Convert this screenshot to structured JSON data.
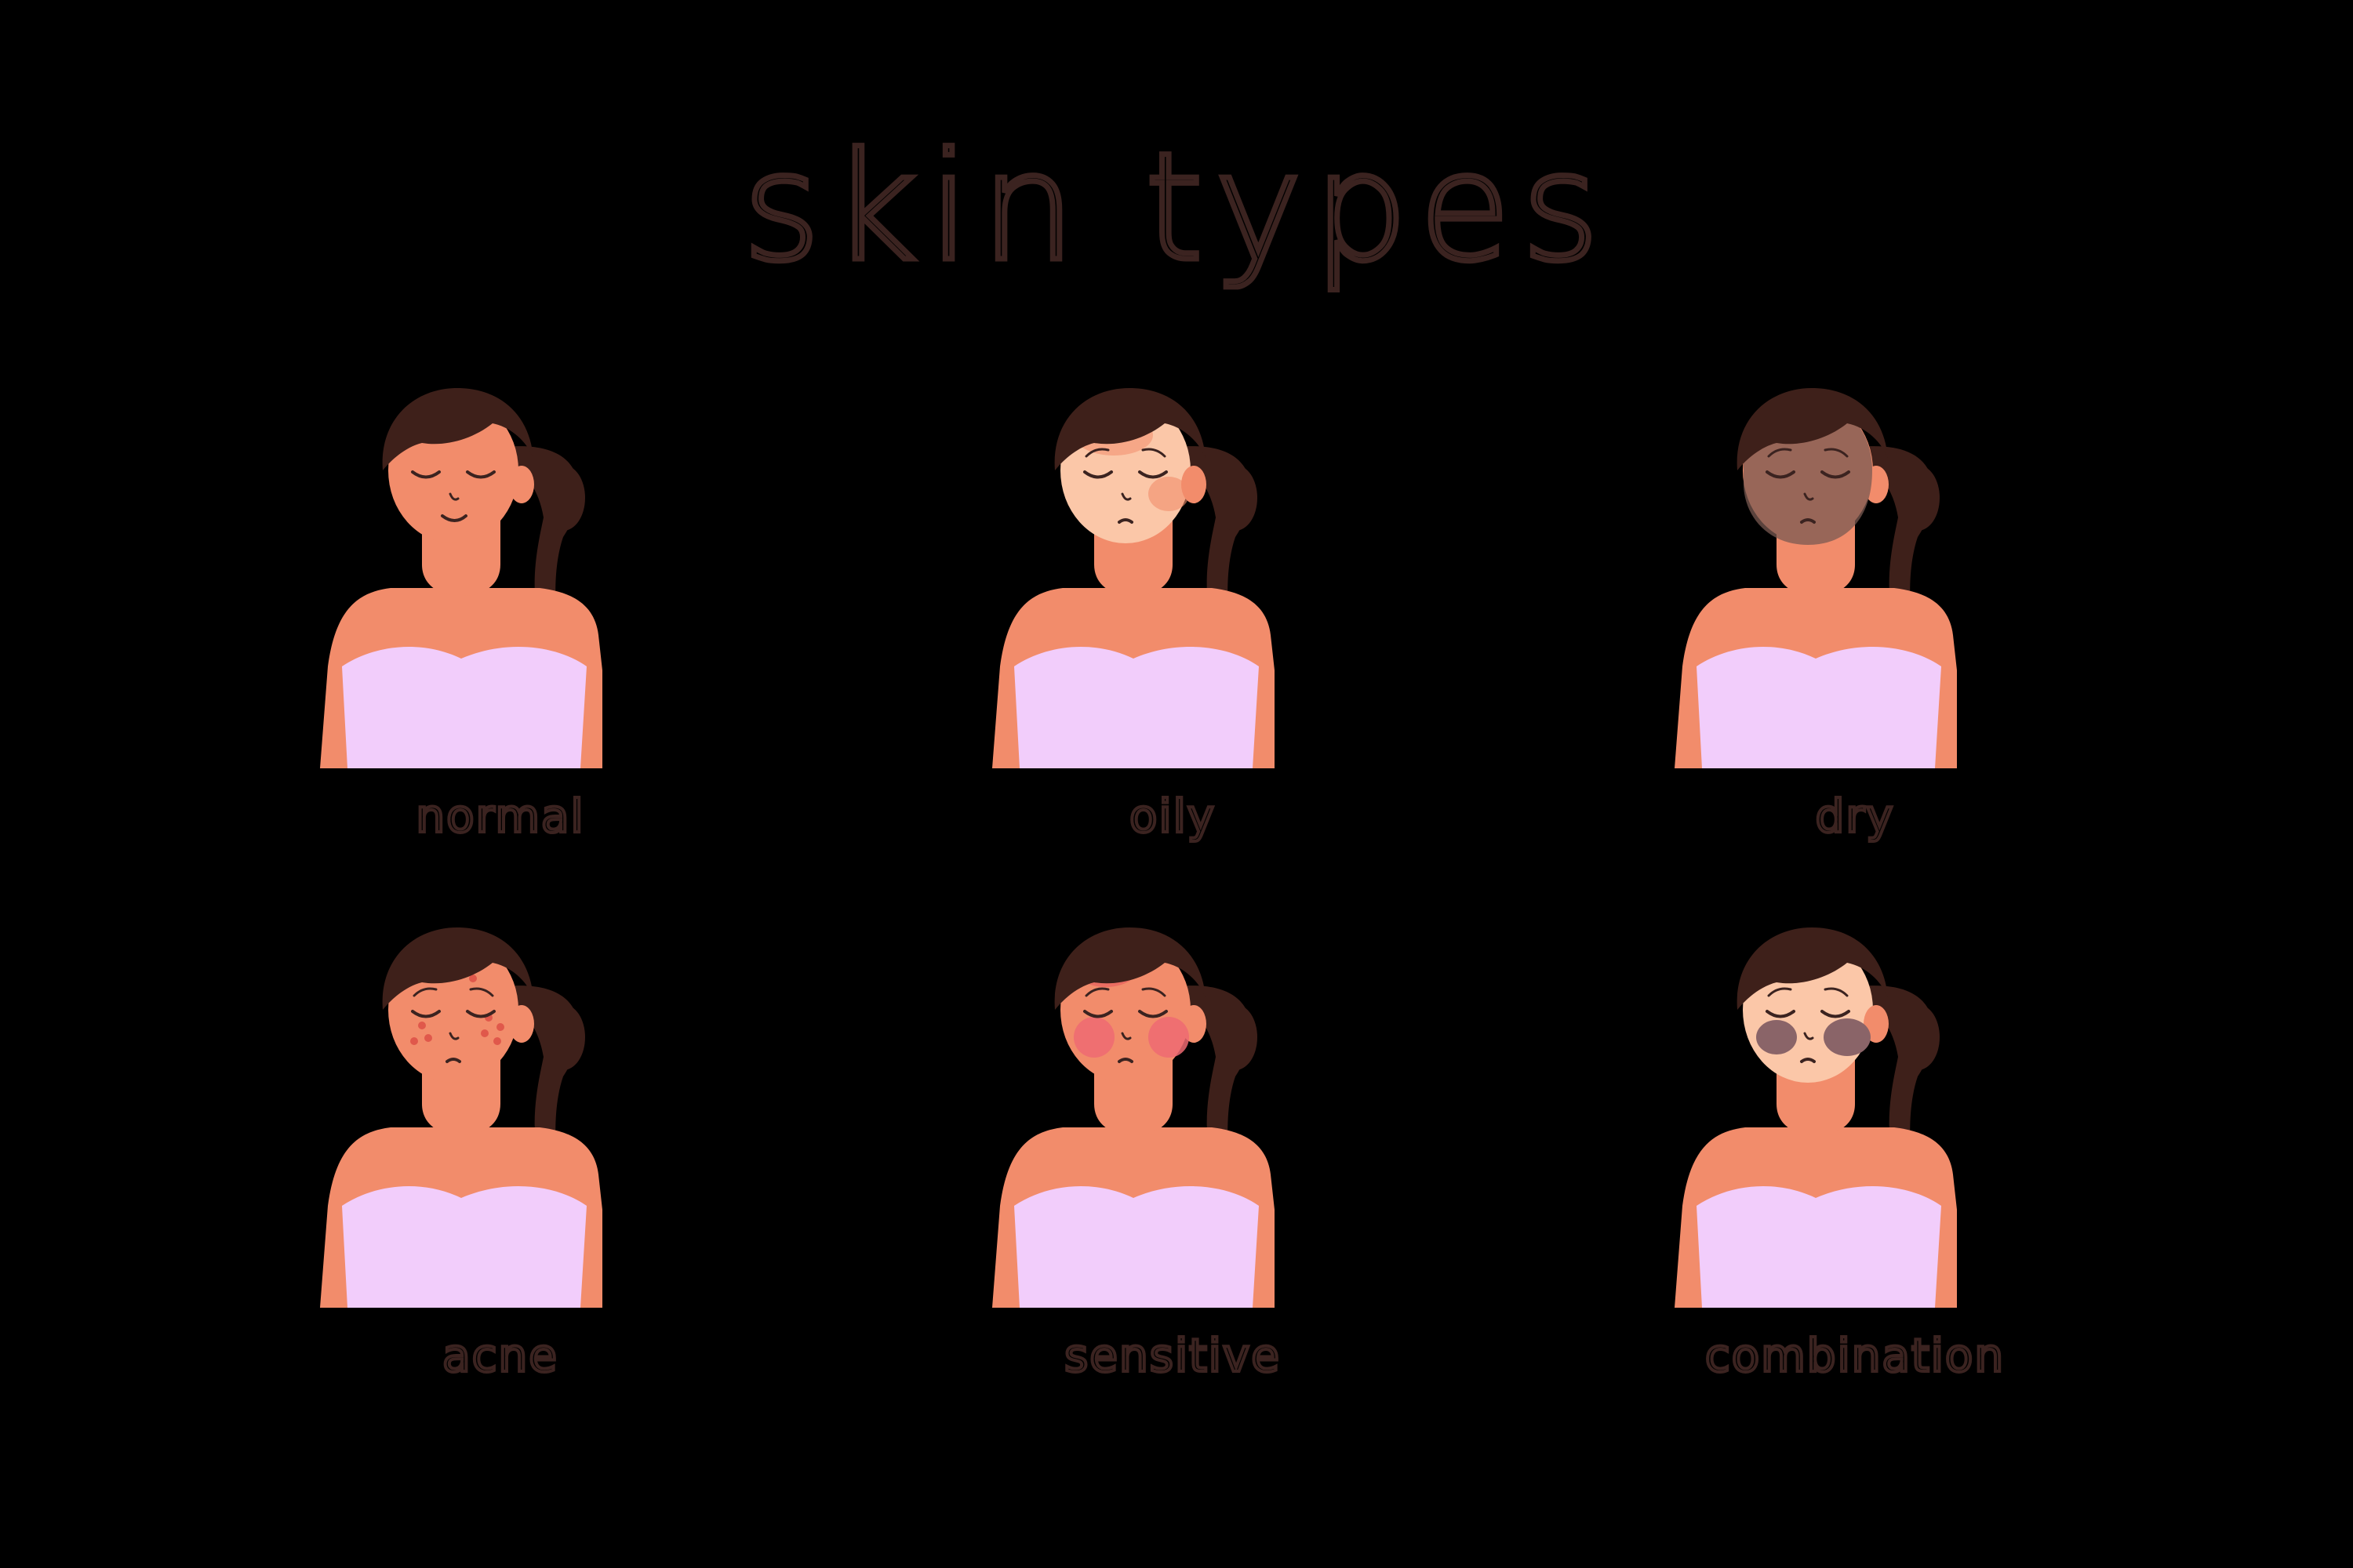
{
  "title": "skin types",
  "colors": {
    "background": "#000000",
    "outline": "#3b2320",
    "hair": "#3e201a",
    "skin": "#f28c6b",
    "face_light": "#fbc7a8",
    "top": "#f2cdfb"
  },
  "portraits": [
    {
      "label": "normal",
      "feature": "normal"
    },
    {
      "label": "oily",
      "feature": "oily"
    },
    {
      "label": "dry",
      "feature": "dry"
    },
    {
      "label": "acne",
      "feature": "acne"
    },
    {
      "label": "sensitive",
      "feature": "sensitive"
    },
    {
      "label": "combination",
      "feature": "combination"
    }
  ]
}
